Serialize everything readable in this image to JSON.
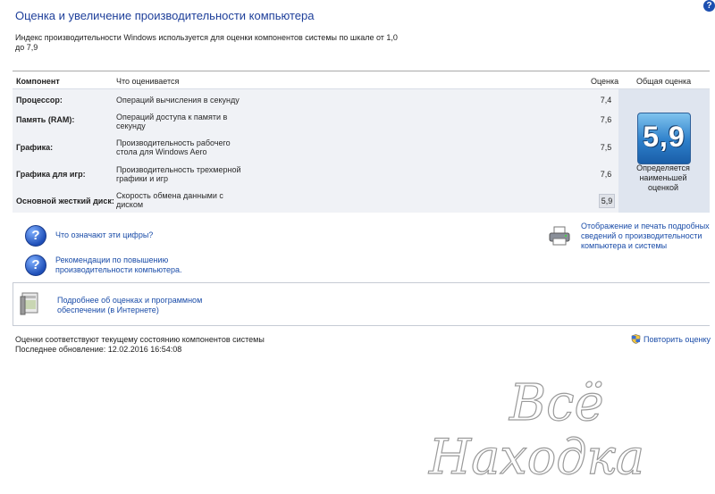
{
  "page": {
    "title": "Оценка и увеличение производительности компьютера",
    "description": "Индекс производительности Windows используется для оценки компонентов системы по шкале от 1,0 до 7,9"
  },
  "table": {
    "headers": {
      "component": "Компонент",
      "what": "Что оценивается",
      "score": "Оценка",
      "overall": "Общая оценка"
    },
    "rows": [
      {
        "component": "Процессор:",
        "what": "Операций вычисления в секунду",
        "score": "7,4"
      },
      {
        "component": "Память (RAM):",
        "what": "Операций доступа к памяти в секунду",
        "score": "7,6"
      },
      {
        "component": "Графика:",
        "what": "Производительность рабочего стола для Windows Aero",
        "score": "7,5"
      },
      {
        "component": "Графика для игр:",
        "what": "Производительность трехмерной графики и игр",
        "score": "7,6"
      },
      {
        "component": "Основной жесткий диск:",
        "what": "Скорость обмена данными с диском",
        "score": "5,9"
      }
    ],
    "overall_score": "5,9",
    "overall_caption": "Определяется наименьшей оценкой"
  },
  "links": {
    "what_numbers_mean": "Что означают эти цифры?",
    "recommendations": "Рекомендации по повышению производительности компьютера.",
    "print_details": "Отображение и печать подробных сведений о производительности компьютера и системы",
    "more_info": "Подробнее об оценках и программном обеспечении (в Интернете)"
  },
  "footer": {
    "status_line": "Оценки соответствуют текущему состоянию компонентов системы",
    "last_update": "Последнее обновление: 12.02.2016 16:54:08",
    "rerun_label": "Повторить оценку"
  },
  "watermark": {
    "line1": "Всё",
    "line2": "Находка"
  },
  "colors": {
    "title": "#1e3f9a",
    "link": "#1a4ca8",
    "tile": "#2d7fca"
  }
}
